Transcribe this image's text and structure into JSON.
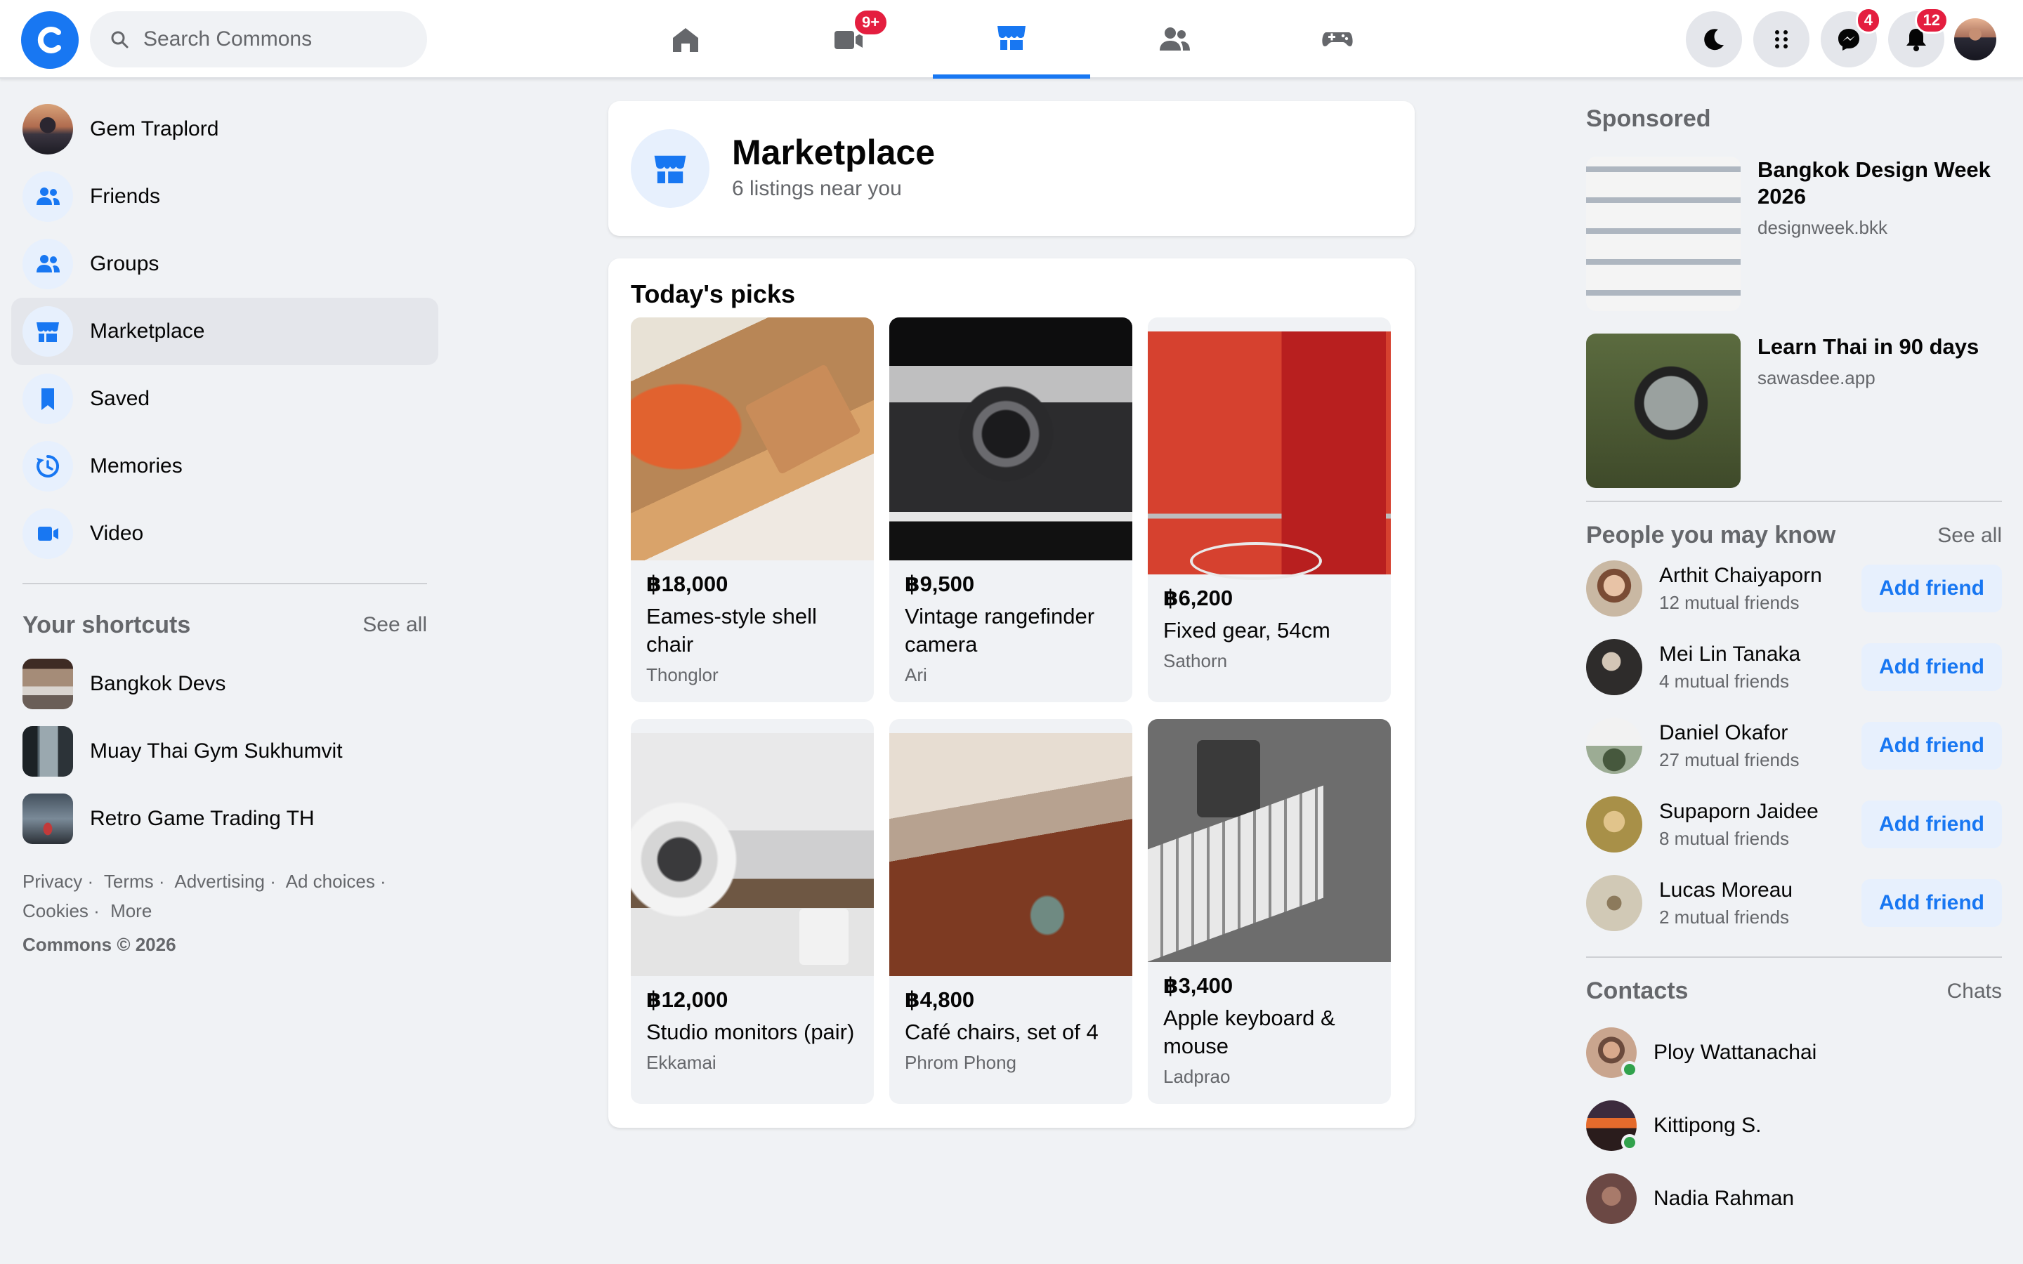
{
  "search": {
    "placeholder": "Search Commons"
  },
  "nav": {
    "tabs": [
      {
        "name": "home",
        "icon": "home-icon"
      },
      {
        "name": "video",
        "icon": "video-icon",
        "badge": "9+"
      },
      {
        "name": "marketplace",
        "icon": "storefront-icon",
        "active": true
      },
      {
        "name": "friends",
        "icon": "friends-icon"
      },
      {
        "name": "gaming",
        "icon": "gamepad-icon"
      }
    ],
    "messenger_badge": "4",
    "notifications_badge": "12"
  },
  "sidebar": {
    "items": [
      {
        "label": "Gem Traplord",
        "icon": "profile-avatar"
      },
      {
        "label": "Friends",
        "icon": "friends-icon"
      },
      {
        "label": "Groups",
        "icon": "groups-icon"
      },
      {
        "label": "Marketplace",
        "icon": "storefront-icon",
        "active": true
      },
      {
        "label": "Saved",
        "icon": "bookmark-icon"
      },
      {
        "label": "Memories",
        "icon": "memories-icon"
      },
      {
        "label": "Video",
        "icon": "video-icon"
      }
    ],
    "shortcuts_title": "Your shortcuts",
    "shortcuts_see_all": "See all",
    "shortcuts": [
      {
        "label": "Bangkok Devs"
      },
      {
        "label": "Muay Thai Gym Sukhumvit"
      },
      {
        "label": "Retro Game Trading TH"
      }
    ],
    "footer_links": [
      "Privacy ·",
      "Terms ·",
      "Advertising ·",
      "Ad choices ·",
      "Cookies ·",
      "More"
    ],
    "copyright": "Commons © 2026"
  },
  "marketplace": {
    "title": "Marketplace",
    "subtitle": "6 listings near you",
    "picks_title": "Today's picks",
    "listings": [
      {
        "price": "฿18,000",
        "title": "Eames-style shell chair",
        "location": "Thonglor"
      },
      {
        "price": "฿9,500",
        "title": "Vintage rangefinder camera",
        "location": "Ari"
      },
      {
        "price": "฿6,200",
        "title": "Fixed gear, 54cm",
        "location": "Sathorn"
      },
      {
        "price": "฿12,000",
        "title": "Studio monitors (pair)",
        "location": "Ekkamai"
      },
      {
        "price": "฿4,800",
        "title": "Café chairs, set of 4",
        "location": "Phrom Phong"
      },
      {
        "price": "฿3,400",
        "title": "Apple keyboard & mouse",
        "location": "Ladprao"
      }
    ]
  },
  "right": {
    "sponsored_title": "Sponsored",
    "ads": [
      {
        "title": "Bangkok Design Week 2026",
        "url": "designweek.bkk"
      },
      {
        "title": "Learn Thai in 90 days",
        "url": "sawasdee.app"
      }
    ],
    "pymk_title": "People you may know",
    "pymk_see_all": "See all",
    "add_friend_label": "Add friend",
    "people": [
      {
        "name": "Arthit Chaiyaporn",
        "mutual": "12 mutual friends"
      },
      {
        "name": "Mei Lin Tanaka",
        "mutual": "4 mutual friends"
      },
      {
        "name": "Daniel Okafor",
        "mutual": "27 mutual friends"
      },
      {
        "name": "Supaporn Jaidee",
        "mutual": "8 mutual friends"
      },
      {
        "name": "Lucas Moreau",
        "mutual": "2 mutual friends"
      }
    ],
    "contacts_title": "Contacts",
    "contacts_link": "Chats",
    "contacts": [
      {
        "name": "Ploy Wattanachai",
        "online": true
      },
      {
        "name": "Kittipong S.",
        "online": true
      },
      {
        "name": "Nadia Rahman",
        "online": false
      }
    ]
  },
  "colors": {
    "accent": "#1877f2",
    "badge": "#e41e3f",
    "online": "#31a24c",
    "background": "#f0f2f5"
  }
}
